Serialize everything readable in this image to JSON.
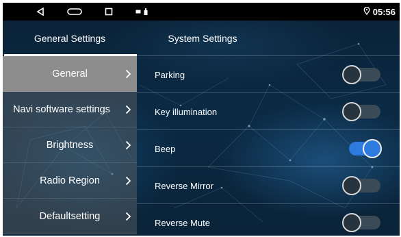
{
  "status_bar": {
    "nav": [
      "back-icon",
      "home-icon",
      "recent-apps-icon"
    ],
    "notifications": [
      "sim-icon",
      "usb-icon"
    ],
    "location_icon": "location-icon",
    "time": "05:56"
  },
  "tabs": [
    {
      "label": "General Settings",
      "active": true
    },
    {
      "label": "System Settings",
      "active": false
    }
  ],
  "menu": [
    {
      "label": "General",
      "selected": true
    },
    {
      "label": "Navi software settings",
      "selected": false
    },
    {
      "label": "Brightness",
      "selected": false
    },
    {
      "label": "Radio Region",
      "selected": false
    },
    {
      "label": "Defaultsetting",
      "selected": false
    }
  ],
  "settings": [
    {
      "label": "Parking",
      "enabled": false
    },
    {
      "label": "Key illumination",
      "enabled": false
    },
    {
      "label": "Beep",
      "enabled": true
    },
    {
      "label": "Reverse Mirror",
      "enabled": false
    },
    {
      "label": "Reverse Mute",
      "enabled": false
    }
  ],
  "colors": {
    "accent": "#2e7be0",
    "selected_menu": "#8d8d8d",
    "status_bar": "#000000"
  }
}
